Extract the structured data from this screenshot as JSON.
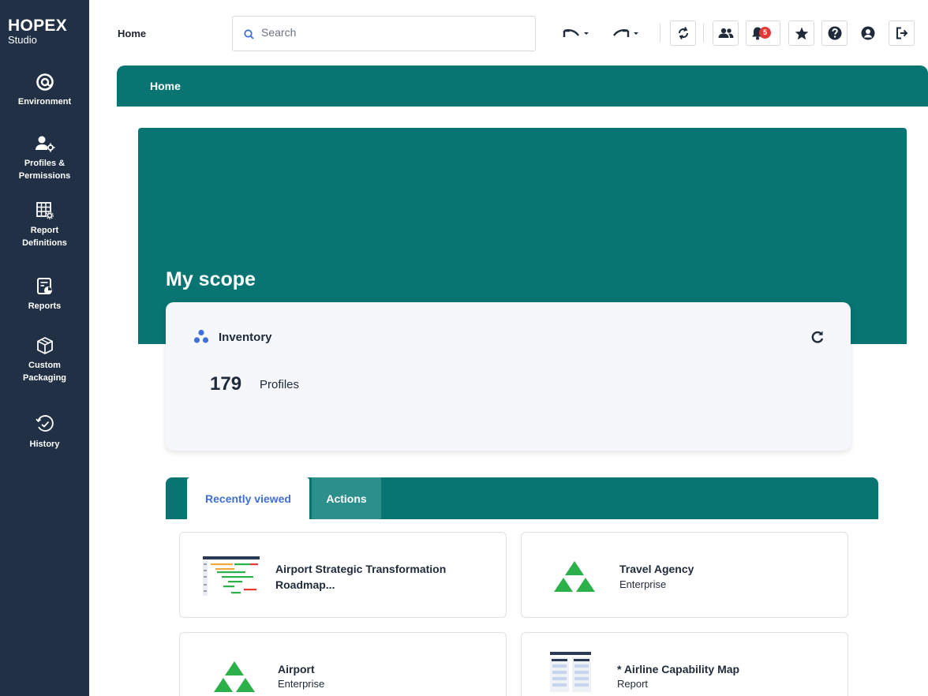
{
  "brand": {
    "name": "HOPEX",
    "sub": "Studio"
  },
  "sidebar": {
    "items": [
      {
        "label": "Environment",
        "icon": "at-target-icon"
      },
      {
        "label_line1": "Profiles &",
        "label_line2": "Permissions",
        "icon": "user-gear-icon"
      },
      {
        "label_line1": "Report",
        "label_line2": "Definitions",
        "icon": "grid-gear-icon"
      },
      {
        "label": "Reports",
        "icon": "report-chart-icon"
      },
      {
        "label_line1": "Custom",
        "label_line2": "Packaging",
        "icon": "package-box-icon"
      },
      {
        "label": "History",
        "icon": "history-clock-icon"
      }
    ]
  },
  "topbar": {
    "title": "Home",
    "search_placeholder": "Search",
    "notifications_count": "5"
  },
  "panel": {
    "title": "Home"
  },
  "hero": {
    "title": "My scope"
  },
  "inventory": {
    "title": "Inventory",
    "count": "179",
    "unit": "Profiles"
  },
  "tabs": {
    "recently_viewed": "Recently viewed",
    "actions": "Actions"
  },
  "recent": [
    {
      "title_line1": "Airport Strategic Transformation",
      "title_line2": "Roadmap...",
      "subtitle": ""
    },
    {
      "title": "Travel Agency",
      "subtitle": "Enterprise"
    },
    {
      "title": "Airport",
      "subtitle": "Enterprise"
    },
    {
      "title": "* Airline Capability Map",
      "subtitle": "Report"
    }
  ],
  "colors": {
    "sidebar": "#213044",
    "teal": "#087572",
    "accent_blue": "#3f6fd8",
    "enterprise_green": "#2bb04a",
    "badge_red": "#e53935"
  }
}
